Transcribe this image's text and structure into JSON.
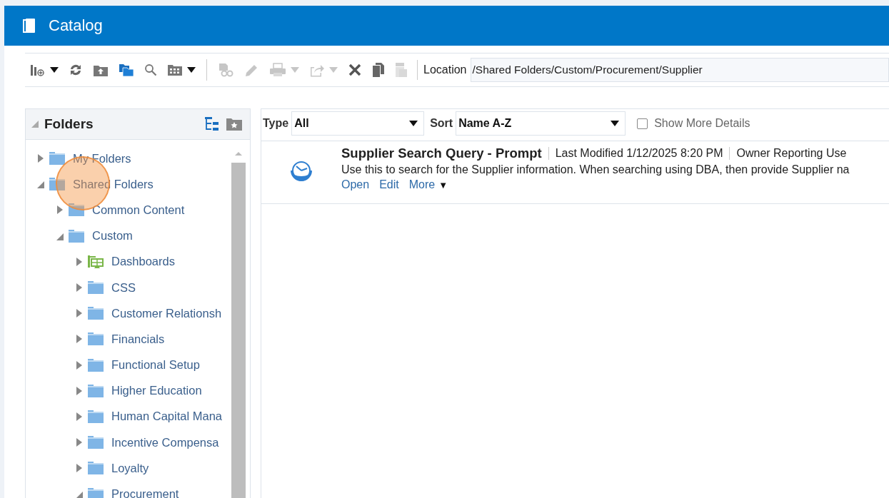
{
  "window": {
    "title": "Catalog"
  },
  "toolbar": {
    "buttons": [
      {
        "kind": "new",
        "disabled": false,
        "menu": true
      },
      {
        "kind": "refresh",
        "disabled": false,
        "menu": false
      },
      {
        "kind": "upload",
        "disabled": false,
        "menu": false
      },
      {
        "kind": "folders",
        "disabled": false,
        "menu": false
      },
      {
        "kind": "search",
        "disabled": false,
        "menu": false
      },
      {
        "kind": "view",
        "disabled": false,
        "menu": true
      },
      {
        "kind": "divider"
      },
      {
        "kind": "properties",
        "disabled": true,
        "menu": false
      },
      {
        "kind": "edit",
        "disabled": true,
        "menu": false
      },
      {
        "kind": "print",
        "disabled": true,
        "menu": true
      },
      {
        "kind": "share",
        "disabled": true,
        "menu": true
      },
      {
        "kind": "delete",
        "disabled": false,
        "menu": false
      },
      {
        "kind": "copy",
        "disabled": false,
        "menu": false
      },
      {
        "kind": "paste",
        "disabled": true,
        "menu": false
      }
    ],
    "location_label": "Location",
    "location": "/Shared Folders/Custom/Procurement/Supplier"
  },
  "folders": {
    "title": "Folders",
    "tree": [
      {
        "label": "My Folders",
        "kind": "folder",
        "expanded": false
      },
      {
        "label": "Shared Folders",
        "kind": "folder",
        "expanded": true,
        "children": [
          {
            "label": "Common Content",
            "kind": "folder",
            "expanded": false
          },
          {
            "label": "Custom",
            "kind": "folder",
            "expanded": true,
            "children": [
              {
                "label": "Dashboards",
                "kind": "dashboard",
                "expanded": false
              },
              {
                "label": "CSS",
                "kind": "folder",
                "expanded": false
              },
              {
                "label": "Customer Relationsh",
                "kind": "folder",
                "expanded": false
              },
              {
                "label": "Financials",
                "kind": "folder",
                "expanded": false
              },
              {
                "label": "Functional Setup",
                "kind": "folder",
                "expanded": false
              },
              {
                "label": "Higher Education",
                "kind": "folder",
                "expanded": false
              },
              {
                "label": "Human Capital Mana",
                "kind": "folder",
                "expanded": false
              },
              {
                "label": "Incentive Compensa",
                "kind": "folder",
                "expanded": false
              },
              {
                "label": "Loyalty",
                "kind": "folder",
                "expanded": false
              },
              {
                "label": "Procurement",
                "kind": "folder",
                "expanded": true
              }
            ]
          }
        ]
      }
    ]
  },
  "filters": {
    "type_label": "Type",
    "type_value": "All",
    "sort_label": "Sort",
    "sort_value": "Name A-Z",
    "details_label": "Show More Details",
    "details_checked": false
  },
  "items": [
    {
      "title": "Supplier Search Query - Prompt",
      "modified": "Last Modified 1/12/2025 8:20 PM",
      "owner": "Owner Reporting Use",
      "description": "Use this to search for the Supplier information. When searching using DBA, then provide Supplier na",
      "actions": [
        "Open",
        "Edit",
        "More"
      ],
      "more_icon": "▼"
    }
  ]
}
